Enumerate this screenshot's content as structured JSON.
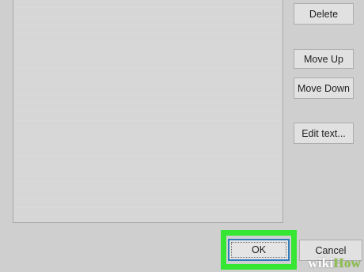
{
  "buttons": {
    "delete": "Delete",
    "move_up": "Move Up",
    "move_down": "Move Down",
    "edit_text": "Edit text...",
    "ok": "OK",
    "cancel": "Cancel"
  },
  "watermark": {
    "part1": "wiki",
    "part2": "How"
  },
  "colors": {
    "dialog_bg": "#cfcfcf",
    "button_face": "#e1e1e1",
    "highlight_green": "#35e632",
    "focus_blue": "#2f7ab8"
  }
}
